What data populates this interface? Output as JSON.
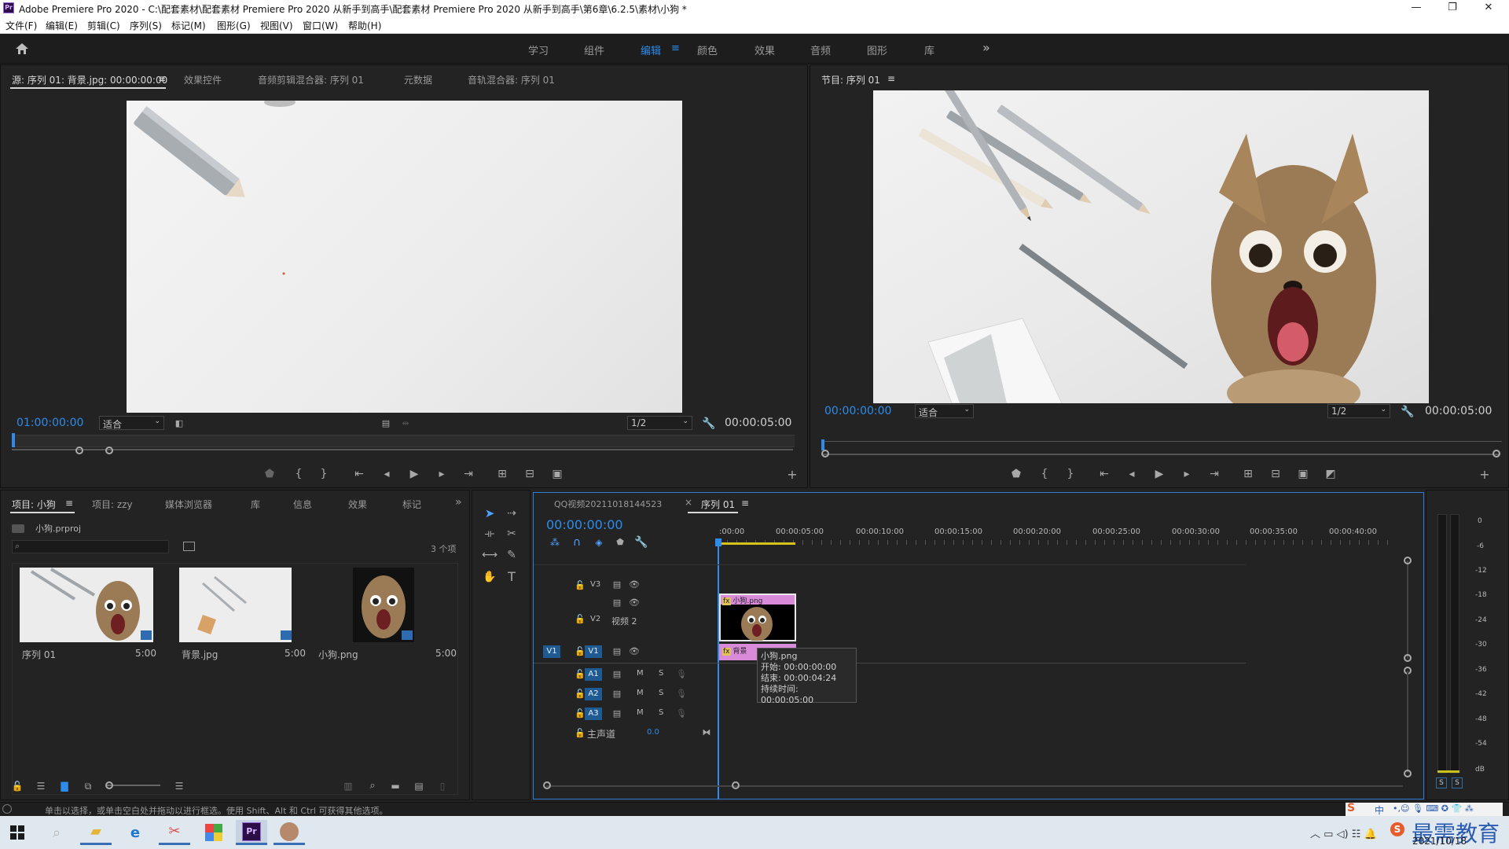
{
  "titlebar": {
    "app_icon": "Pr",
    "title": "Adobe Premiere Pro 2020 - C:\\配套素材\\配套素材 Premiere Pro 2020 从新手到高手\\配套素材 Premiere Pro 2020 从新手到高手\\第6章\\6.2.5\\素材\\小狗 *",
    "minimize": "—",
    "maximize": "❐",
    "close": "✕"
  },
  "menu": [
    "文件(F)",
    "编辑(E)",
    "剪辑(C)",
    "序列(S)",
    "标记(M)",
    "图形(G)",
    "视图(V)",
    "窗口(W)",
    "帮助(H)"
  ],
  "workspaces": {
    "items": [
      "学习",
      "组件",
      "编辑",
      "颜色",
      "效果",
      "音频",
      "图形",
      "库"
    ],
    "active": "编辑",
    "menu_icon": "≡",
    "more": "»",
    "home_icon": "home-icon"
  },
  "source_panel": {
    "tabs": [
      "源: 序列 01: 背景.jpg: 00:00:00:00",
      "效果控件",
      "音频剪辑混合器: 序列 01",
      "元数据",
      "音轨混合器: 序列 01"
    ],
    "tab_menu": "≡",
    "timecode_in": "01:00:00:00",
    "fit": "适合",
    "resolution": "1/2",
    "duration": "00:00:05:00"
  },
  "program_panel": {
    "tab": "节目: 序列 01",
    "tab_menu": "≡",
    "timecode_in": "00:00:00:00",
    "fit": "适合",
    "resolution": "1/2",
    "duration": "00:00:05:00"
  },
  "project_panel": {
    "tabs": [
      "项目: 小狗",
      "项目: zzy",
      "媒体浏览器",
      "库",
      "信息",
      "效果",
      "标记"
    ],
    "more": "»",
    "tab_menu": "≡",
    "file": "小狗.prproj",
    "count": "3 个项",
    "items": [
      {
        "name": "序列 01",
        "duration": "5:00"
      },
      {
        "name": "背景.jpg",
        "duration": "5:00"
      },
      {
        "name": "小狗.png",
        "duration": "5:00"
      }
    ]
  },
  "timeline": {
    "tabs": [
      "QQ视频20211018144523",
      "序列 01"
    ],
    "tab_close": "×",
    "tab_menu": "≡",
    "timecode": "00:00:00:00",
    "ruler": [
      ":00:00",
      "00:00:05:00",
      "00:00:10:00",
      "00:00:15:00",
      "00:00:20:00",
      "00:00:25:00",
      "00:00:30:00",
      "00:00:35:00",
      "00:00:40:00"
    ],
    "tracks_video": [
      {
        "id": "V3",
        "name": ""
      },
      {
        "id": "V2",
        "name": "视频 2"
      },
      {
        "id": "V1",
        "name": ""
      }
    ],
    "tracks_audio": [
      {
        "id": "A1"
      },
      {
        "id": "A2"
      },
      {
        "id": "A3"
      }
    ],
    "source_patch": "V1",
    "mute": "M",
    "solo": "S",
    "master": {
      "label": "主声道",
      "value": "0.0"
    },
    "clip_v2": {
      "label": "小狗.png",
      "fx": "fx"
    },
    "clip_v1": {
      "label": "背景",
      "fx": "fx"
    },
    "tooltip": {
      "name": "小狗.png",
      "start": "开始: 00:00:00:00",
      "end": "结束: 00:00:04:24",
      "duration": "持续时间: 00:00:05:00"
    }
  },
  "audio_meter": {
    "scale": [
      "0",
      "-6",
      "-12",
      "-18",
      "-24",
      "-30",
      "-36",
      "-42",
      "-48",
      "-54",
      "dB"
    ],
    "solo_buttons": [
      "S",
      "S"
    ]
  },
  "status": "单击以选择，或单击空白处并拖动以进行框选。使用 Shift、Alt 和 Ctrl 可获得其他选项。",
  "taskbar": {
    "date": "2021/10/18",
    "ime": "中",
    "watermark": "最需教育"
  }
}
